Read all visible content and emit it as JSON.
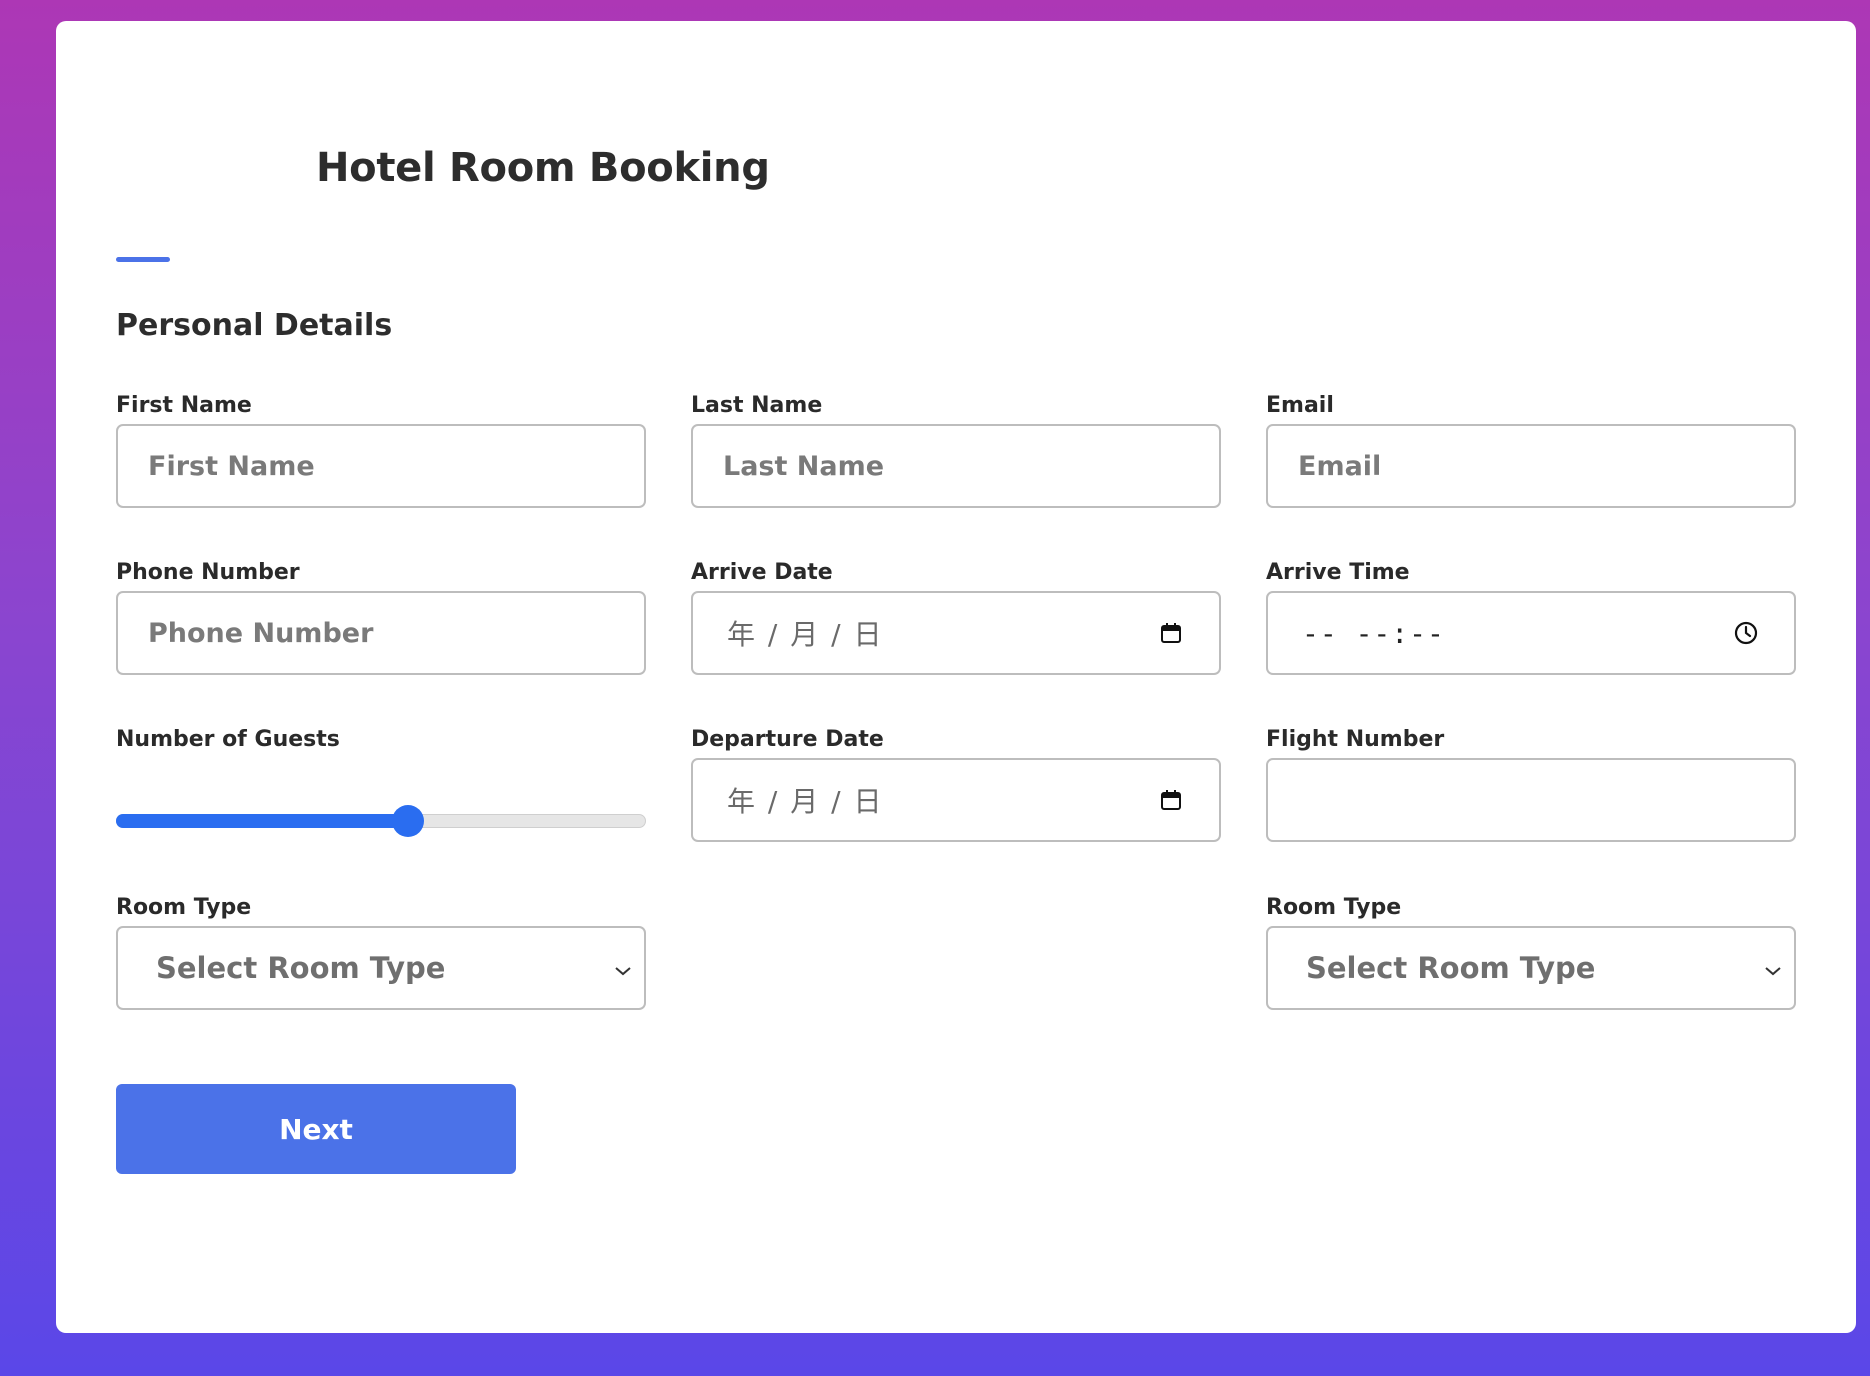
{
  "header": {
    "title": "Hotel Room Booking"
  },
  "section": {
    "title": "Personal Details"
  },
  "fields": {
    "first_name": {
      "label": "First Name",
      "placeholder": "First Name"
    },
    "last_name": {
      "label": "Last Name",
      "placeholder": "Last Name"
    },
    "email": {
      "label": "Email",
      "placeholder": "Email"
    },
    "phone": {
      "label": "Phone Number",
      "placeholder": "Phone Number"
    },
    "arrive_date": {
      "label": "Arrive Date",
      "display": "年 / 月 / 日",
      "icon": "calendar-icon"
    },
    "arrive_time": {
      "label": "Arrive Time",
      "display": "-- --:--",
      "icon": "clock-icon"
    },
    "guests": {
      "label": "Number of Guests",
      "value_fraction": 0.55
    },
    "departure_date": {
      "label": "Departure Date",
      "display": "年 / 月 / 日",
      "icon": "calendar-icon"
    },
    "flight_number": {
      "label": "Flight Number",
      "placeholder": ""
    },
    "room_type_left": {
      "label": "Room Type",
      "selected": "Select Room Type",
      "icon": "chevron-down-icon"
    },
    "room_type_right": {
      "label": "Room Type",
      "selected": "Select Room Type",
      "icon": "chevron-down-icon"
    }
  },
  "actions": {
    "next_label": "Next"
  },
  "colors": {
    "accent": "#4b72e8",
    "slider": "#2a6df0",
    "gradient_top": "#ad37b5",
    "gradient_bottom": "#5a47e8"
  }
}
